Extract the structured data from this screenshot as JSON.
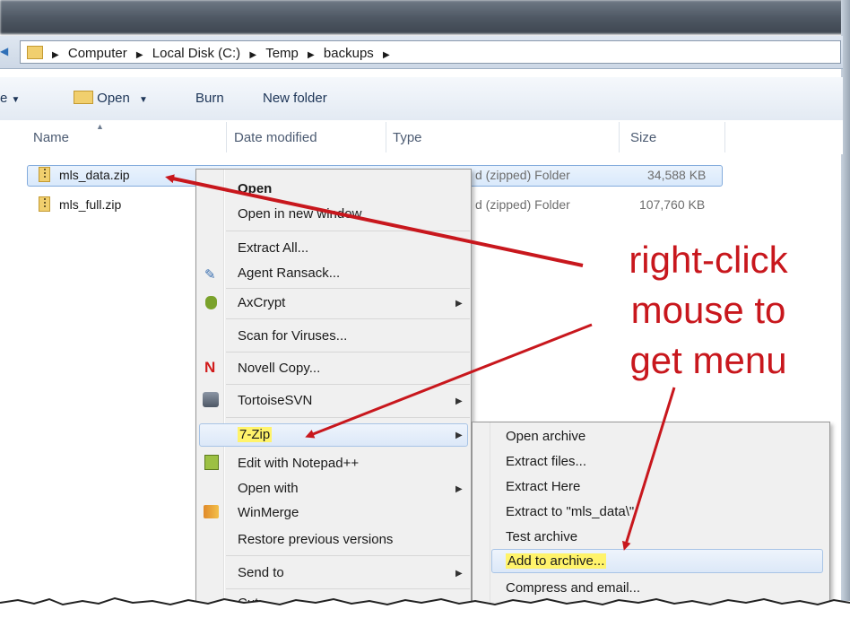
{
  "address": {
    "breadcrumbs": [
      "Computer",
      "Local Disk (C:)",
      "Temp",
      "backups"
    ]
  },
  "toolbar": {
    "partial_label": "e",
    "open_label": "Open",
    "burn_label": "Burn",
    "new_folder_label": "New folder"
  },
  "columns": {
    "name": "Name",
    "date_modified": "Date modified",
    "type": "Type",
    "size": "Size"
  },
  "files": [
    {
      "name": "mls_data.zip",
      "type": "d (zipped) Folder",
      "size": "34,588 KB",
      "selected": true
    },
    {
      "name": "mls_full.zip",
      "type": "d (zipped) Folder",
      "size": "107,760 KB",
      "selected": false
    }
  ],
  "context_menu": {
    "items": [
      {
        "label": "Open",
        "bold": true
      },
      {
        "label": "Open in new window"
      },
      {
        "label": "Extract All..."
      },
      {
        "label": "Agent Ransack..."
      },
      {
        "label": "AxCrypt",
        "submenu": true
      },
      {
        "label": "Scan for Viruses..."
      },
      {
        "label": "Novell Copy..."
      },
      {
        "label": "TortoiseSVN",
        "submenu": true
      },
      {
        "label": "7-Zip",
        "submenu": true,
        "highlighted": true
      },
      {
        "label": "Edit with Notepad++"
      },
      {
        "label": "Open with",
        "submenu": true
      },
      {
        "label": "WinMerge"
      },
      {
        "label": "Restore previous versions"
      },
      {
        "label": "Send to",
        "submenu": true
      },
      {
        "label": "Cut"
      }
    ],
    "novell_glyph": "N"
  },
  "sevenzip_submenu": {
    "items": [
      {
        "label": "Open archive"
      },
      {
        "label": "Extract files..."
      },
      {
        "label": "Extract Here"
      },
      {
        "label": "Extract to \"mls_data\\\""
      },
      {
        "label": "Test archive"
      },
      {
        "label": "Add to archive...",
        "highlighted": true
      },
      {
        "label": "Compress and email..."
      }
    ]
  },
  "annotation": {
    "lines": [
      "right-click",
      "mouse to",
      "get menu"
    ],
    "color": "#c8171d"
  },
  "colors": {
    "selection": "#d9e9fb",
    "highlight_yellow": "#fff36b",
    "arrow_red": "#c8171d"
  }
}
